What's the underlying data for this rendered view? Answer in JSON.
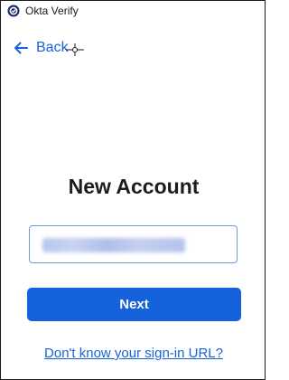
{
  "window": {
    "title": "Okta Verify",
    "icon": "okta-verify-icon"
  },
  "nav": {
    "back_label": "Back",
    "back_icon": "arrow-left-icon"
  },
  "main": {
    "heading": "New Account",
    "url_field": {
      "value_redacted": true
    },
    "next_label": "Next",
    "help_link": "Don't know your sign-in URL?"
  },
  "colors": {
    "accent": "#1662dd",
    "heading": "#1d1d21",
    "input_border": "#6a9fe0"
  }
}
